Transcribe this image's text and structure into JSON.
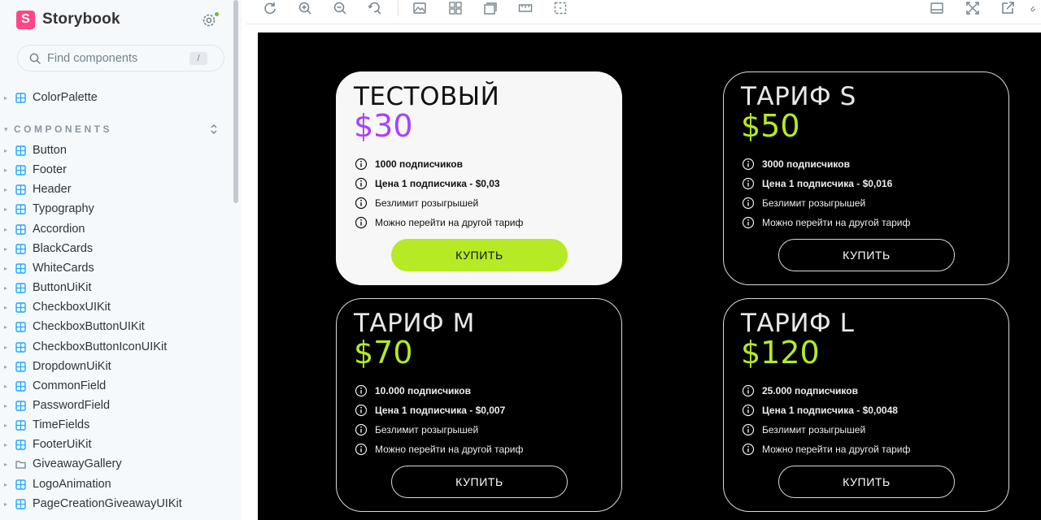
{
  "sidebar": {
    "brand": "Storybook",
    "search_placeholder": "Find components",
    "search_shortcut": "/",
    "top_items": [
      {
        "label": "ColorPalette"
      }
    ],
    "section_title": "COMPONENTS",
    "items": [
      {
        "label": "Button"
      },
      {
        "label": "Footer"
      },
      {
        "label": "Header"
      },
      {
        "label": "Typography"
      },
      {
        "label": "Accordion"
      },
      {
        "label": "BlackCards"
      },
      {
        "label": "WhiteCards"
      },
      {
        "label": "ButtonUiKit"
      },
      {
        "label": "CheckboxUIKit"
      },
      {
        "label": "CheckboxButtonUIKit"
      },
      {
        "label": "CheckboxButtonIconUIKit"
      },
      {
        "label": "DropdownUiKit"
      },
      {
        "label": "CommonField"
      },
      {
        "label": "PasswordField"
      },
      {
        "label": "TimeFields"
      },
      {
        "label": "FooterUiKit"
      },
      {
        "label": "GiveawayGallery",
        "icon": "folder-icon"
      },
      {
        "label": "LogoAnimation"
      },
      {
        "label": "PageCreationGiveawayUIKit"
      }
    ]
  },
  "toolbar": {
    "left_icons": [
      "reload-icon",
      "zoom-in-icon",
      "zoom-out-icon",
      "zoom-reset-icon",
      "image-icon",
      "grid-icon",
      "background-icon",
      "measure-icon",
      "outline-icon"
    ],
    "right_icons": [
      "panel-icon",
      "fullscreen-icon",
      "open-new-tab-icon"
    ]
  },
  "colors": {
    "accent_green": "#b5ea24",
    "accent_purple": "#a742ff",
    "storybook_pink": "#ff4785"
  },
  "cards": [
    {
      "theme": "light",
      "title": "ТЕСТОВЫЙ",
      "price": "$30",
      "features": [
        "1000 подписчиков",
        "Цена 1 подписчика - $0,03",
        "Безлимит розыгрышей",
        "Можно перейти на другой тариф"
      ],
      "button": "КУПИТЬ"
    },
    {
      "theme": "dark",
      "title": "ТАРИФ S",
      "price": "$50",
      "features": [
        "3000 подписчиков",
        "Цена 1 подписчика - $0,016",
        "Безлимит розыгрышей",
        "Можно перейти на другой тариф"
      ],
      "button": "КУПИТЬ"
    },
    {
      "theme": "dark",
      "title": "ТАРИФ M",
      "price": "$70",
      "features": [
        "10.000 подписчиков",
        "Цена 1 подписчика - $0,007",
        "Безлимит розыгрышей",
        "Можно перейти на другой тариф"
      ],
      "button": "КУПИТЬ"
    },
    {
      "theme": "dark",
      "title": "ТАРИФ L",
      "price": "$120",
      "features": [
        "25.000 подписчиков",
        "Цена 1 подписчика - $0,0048",
        "Безлимит розыгрышей",
        "Можно перейти на другой тариф"
      ],
      "button": "КУПИТЬ"
    }
  ]
}
